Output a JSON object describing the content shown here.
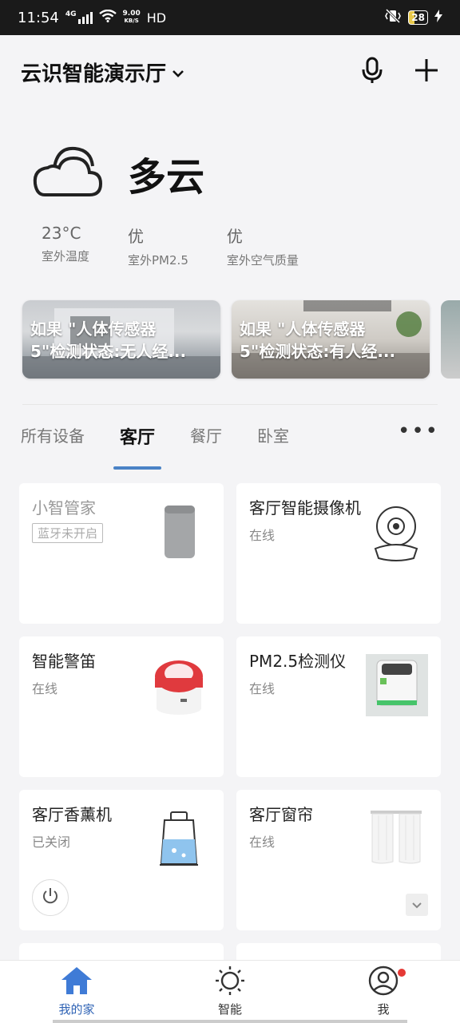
{
  "status_bar": {
    "time": "11:54",
    "net_small": "4G",
    "speed": "9.00",
    "speed_unit": "KB/S",
    "hd": "HD",
    "battery": "28"
  },
  "header": {
    "title": "云识智能演示厅"
  },
  "weather": {
    "condition": "多云",
    "metrics": [
      {
        "value": "23°C",
        "label": "室外温度"
      },
      {
        "value": "优",
        "label": "室外PM2.5"
      },
      {
        "value": "优",
        "label": "室外空气质量"
      }
    ]
  },
  "scenes": [
    {
      "text": "如果 \"人体传感器\n5\"检测状态:无人经..."
    },
    {
      "text": "如果 \"人体传感器\n5\"检测状态:有人经..."
    }
  ],
  "tabs": [
    {
      "label": "所有设备",
      "active": false
    },
    {
      "label": "客厅",
      "active": true
    },
    {
      "label": "餐厅",
      "active": false
    },
    {
      "label": "卧室",
      "active": false
    }
  ],
  "devices": [
    {
      "name": "小智管家",
      "status": "蓝牙未开启"
    },
    {
      "name": "客厅智能摄像机",
      "status": "在线"
    },
    {
      "name": "智能警笛",
      "status": "在线"
    },
    {
      "name": "PM2.5检测仪",
      "status": "在线"
    },
    {
      "name": "客厅香薰机",
      "status": "已关闭"
    },
    {
      "name": "客厅窗帘",
      "status": "在线"
    }
  ],
  "nav": [
    {
      "label": "我的家",
      "icon": "home-icon"
    },
    {
      "label": "智能",
      "icon": "sun-icon"
    },
    {
      "label": "我",
      "icon": "user-icon"
    }
  ],
  "colors": {
    "accent": "#4a82c6",
    "nav_active": "#2f63b5",
    "badge_red": "#e53935"
  }
}
